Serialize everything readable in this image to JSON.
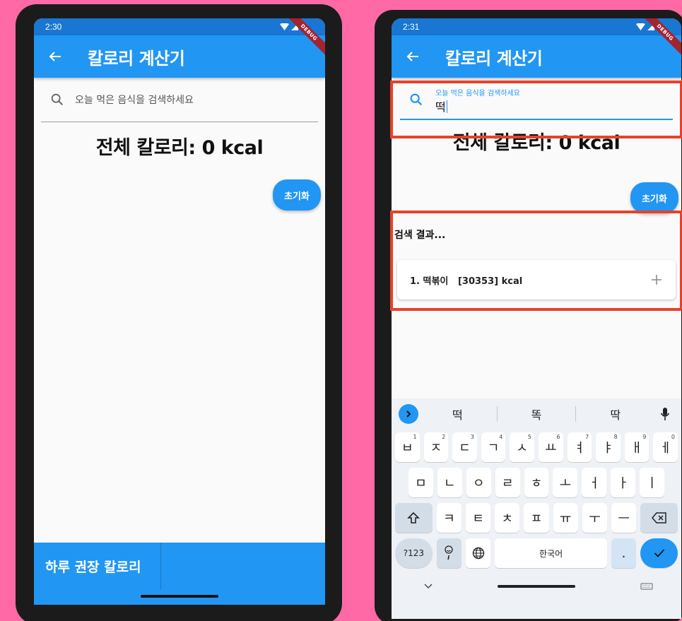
{
  "left": {
    "status_time": "2:30",
    "debug_label": "DEBUG",
    "title": "칼로리 계산기",
    "search_placeholder": "오늘 먹은 음식을 검색하세요",
    "total_text": "전체 칼로리: 0 kcal",
    "reset_label": "초기화",
    "bottom_tab_label": "하루 권장 칼로리"
  },
  "right": {
    "status_time": "2:31",
    "debug_label": "DEBUG",
    "title": "칼로리 계산기",
    "search_label": "오늘 먹은 음식을 검색하세요",
    "search_value": "떡",
    "total_text": "전체 칼로리: 0 kcal",
    "reset_label": "초기화",
    "results_title": "검색 결과...",
    "results": [
      {
        "text": "1. 떡볶이   [30353] kcal"
      }
    ]
  },
  "keyboard": {
    "suggestions": [
      "떡",
      "똑",
      "딱"
    ],
    "row1": [
      {
        "k": "ㅂ",
        "n": "1"
      },
      {
        "k": "ㅈ",
        "n": "2"
      },
      {
        "k": "ㄷ",
        "n": "3"
      },
      {
        "k": "ㄱ",
        "n": "4"
      },
      {
        "k": "ㅅ",
        "n": "5"
      },
      {
        "k": "ㅛ",
        "n": "6"
      },
      {
        "k": "ㅕ",
        "n": "7"
      },
      {
        "k": "ㅑ",
        "n": "8"
      },
      {
        "k": "ㅐ",
        "n": "9"
      },
      {
        "k": "ㅔ",
        "n": "0"
      }
    ],
    "row2": [
      "ㅁ",
      "ㄴ",
      "ㅇ",
      "ㄹ",
      "ㅎ",
      "ㅗ",
      "ㅓ",
      "ㅏ",
      "ㅣ"
    ],
    "row3": [
      "ㅋ",
      "ㅌ",
      "ㅊ",
      "ㅍ",
      "ㅠ",
      "ㅜ",
      "ㅡ"
    ],
    "sym_label": "?123",
    "space_label": "한국어",
    "dot_label": "."
  },
  "colors": {
    "primary": "#2196f3",
    "status": "#1976d2",
    "highlight": "#e8412a",
    "background": "#ff69a6"
  }
}
